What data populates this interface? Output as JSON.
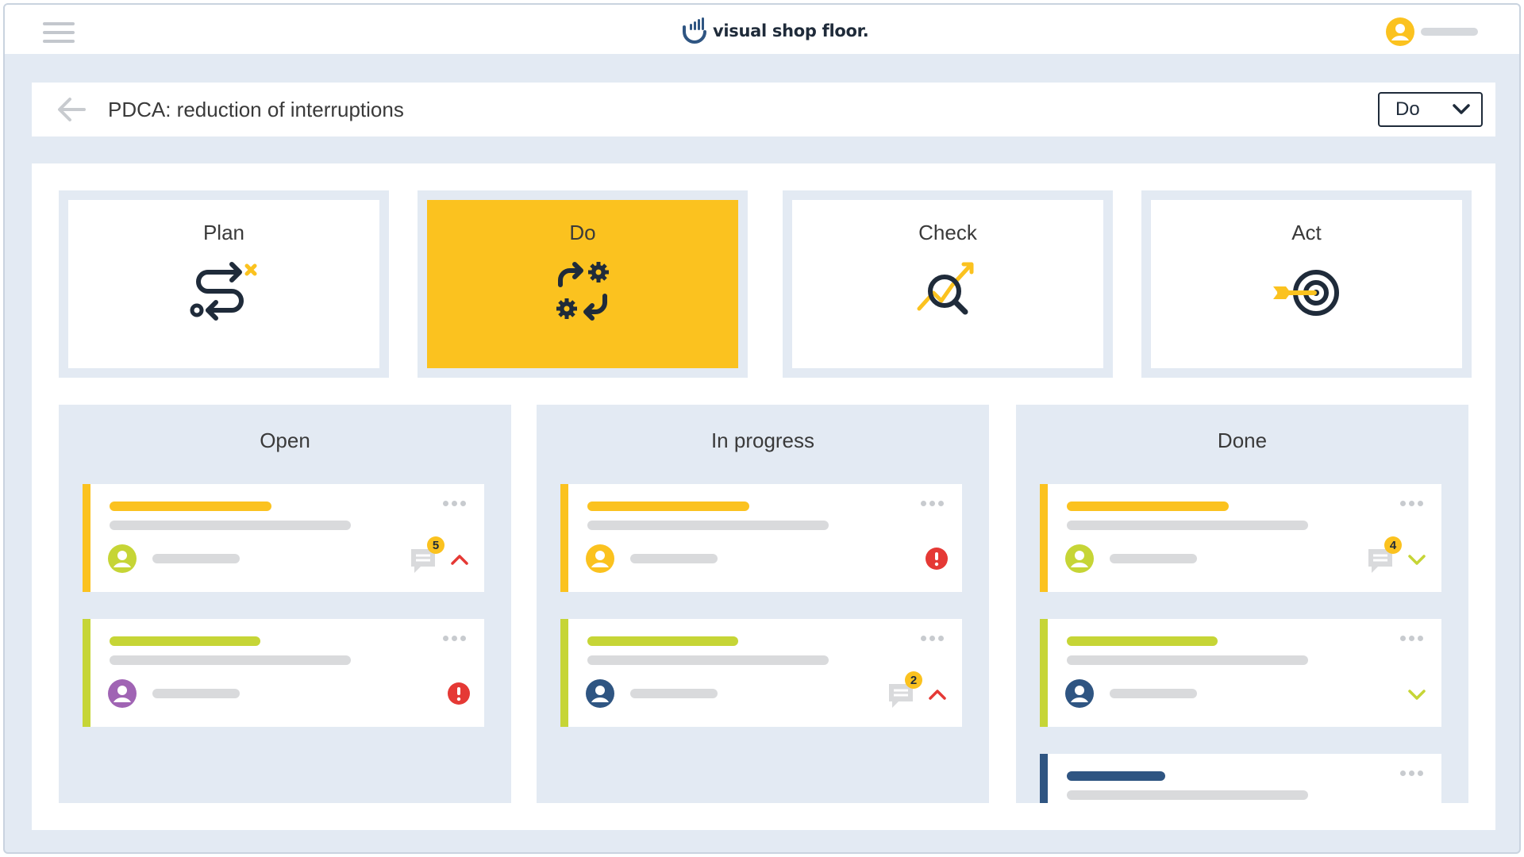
{
  "app": {
    "brand": "visual shop floor."
  },
  "header": {
    "title": "PDCA: reduction of interruptions",
    "phase_select_value": "Do"
  },
  "phases": [
    {
      "label": "Plan",
      "icon": "route-plan-icon",
      "active": false
    },
    {
      "label": "Do",
      "icon": "gears-arrows-icon",
      "active": true
    },
    {
      "label": "Check",
      "icon": "magnifier-chart-icon",
      "active": false
    },
    {
      "label": "Act",
      "icon": "target-arrow-icon",
      "active": false
    }
  ],
  "columns": [
    {
      "title": "Open"
    },
    {
      "title": "In progress"
    },
    {
      "title": "Done"
    }
  ],
  "cards": {
    "open_1_comments": "5",
    "progress_2_comments": "2",
    "done_1_comments": "4"
  },
  "colors": {
    "accent_yellow": "#fbc21f",
    "accent_green": "#c6d536",
    "accent_navy": "#2f5582",
    "alert_red": "#e53935",
    "frame_blue": "#e3eaf3",
    "text_dark": "#1f2b3a"
  }
}
